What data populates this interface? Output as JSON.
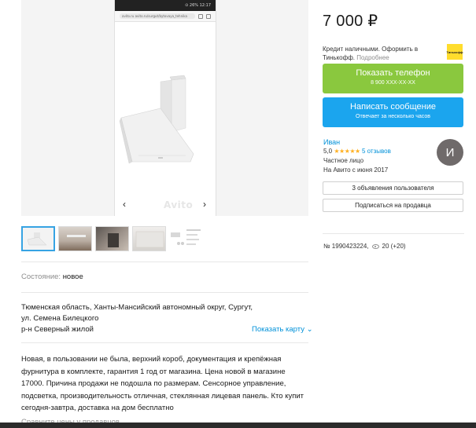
{
  "gallery": {
    "phone_status_text": "⊙ 26% 12:17",
    "phone_url_text": "avito.ru  avito.ru/surgut/bytovaya_tehnika",
    "watermark": "Avito",
    "prev_arrow": "‹",
    "next_arrow": "›",
    "thumbnail_count": 5
  },
  "listing": {
    "condition_label": "Состояние:",
    "condition_value": "новое",
    "address_line1": "Тюменская область, Ханты-Мансийский автономный округ, Сургут,",
    "address_line2": "ул. Семена Билецкого",
    "address_line3": "р-н Северный жилой",
    "show_map": "Показать карту ⌄",
    "description": "Новая, в пользовании не была, верхний короб, документация и крепёжная фурнитура в комплекте, гарантия 1 год от магазина. Цена новой в магазине 17000. Причина продажи не подошла по размерам. Сенсорное управление, подсветка, производительность отличная, стеклянная лицевая панель. Кто купит сегодня-завтра, доставка на дом бесплатно",
    "cutoff_text": "Сравните цены у продавцов"
  },
  "sidebar": {
    "price": "7 000 ₽",
    "credit_text": "Кредит наличными. Оформить в Тинькофф.",
    "credit_more": "Подробнее",
    "tinkoff_logo": "Тинькофф",
    "phone_button": "Показать телефон",
    "phone_number": "8 900 XXX-XX-XX",
    "message_button": "Написать сообщение",
    "message_sub": "Отвечает за несколько часов",
    "seller_name": "Иван",
    "rating_value": "5,0",
    "rating_stars": "★★★★★",
    "reviews": "5 отзывов",
    "seller_type": "Частное лицо",
    "seller_since": "На Авито с июня 2017",
    "avatar_letter": "И",
    "user_ads_button": "3 объявления пользователя",
    "subscribe_button": "Подписаться на продавца",
    "listing_number": "№ 1990423224,",
    "views": "20 (+20)"
  },
  "colors": {
    "green_button": "#8ac83e",
    "blue_button": "#1ba5ee",
    "link": "#0091d9",
    "stars": "#ffb021",
    "tinkoff_yellow": "#ffdd2d"
  }
}
